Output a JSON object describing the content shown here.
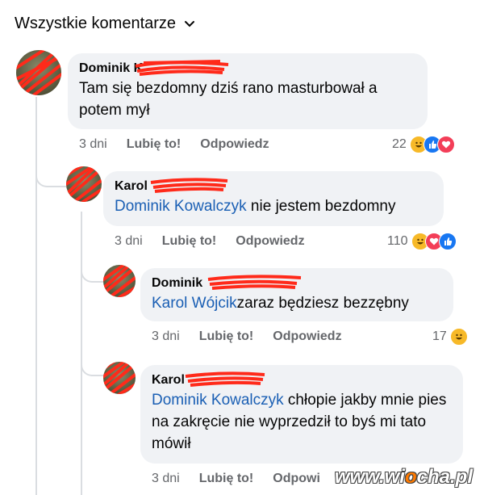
{
  "header": {
    "title": "Wszystkie komentarze"
  },
  "comments": [
    {
      "author": "Dominik K",
      "text": "Tam się bezdomny dziś rano masturbował a potem mył",
      "time": "3 dni",
      "like_label": "Lubię to!",
      "reply_label": "Odpowiedz",
      "reaction_count": "22",
      "reactions": [
        "haha",
        "like",
        "love"
      ]
    },
    {
      "author": "Karol",
      "mention": "Dominik Kowalczyk",
      "text": " nie jestem bezdomny",
      "time": "3 dni",
      "like_label": "Lubię to!",
      "reply_label": "Odpowiedz",
      "reaction_count": "110",
      "reactions": [
        "haha",
        "love",
        "like"
      ]
    },
    {
      "author": "Dominik",
      "mention": "Karol Wójcik",
      "text": "zaraz będziesz bezzębny",
      "time": "3 dni",
      "like_label": "Lubię to!",
      "reply_label": "Odpowiedz",
      "reaction_count": "17",
      "reactions": [
        "haha"
      ]
    },
    {
      "author": "Karol",
      "mention": "Dominik Kowalczyk",
      "text": " chłopie jakby mnie pies na zakręcie nie wyprzedził to byś mi tato mówił",
      "time": "3 dni",
      "like_label": "Lubię to!",
      "reply_label": "Odpowi"
    }
  ],
  "watermark": {
    "prefix": "www.wi",
    "o": "o",
    "suffix": "cha.pl"
  },
  "colors": {
    "mention": "#1a5fb4",
    "bubble": "#f0f2f5",
    "redact": "#ff2a1a"
  }
}
